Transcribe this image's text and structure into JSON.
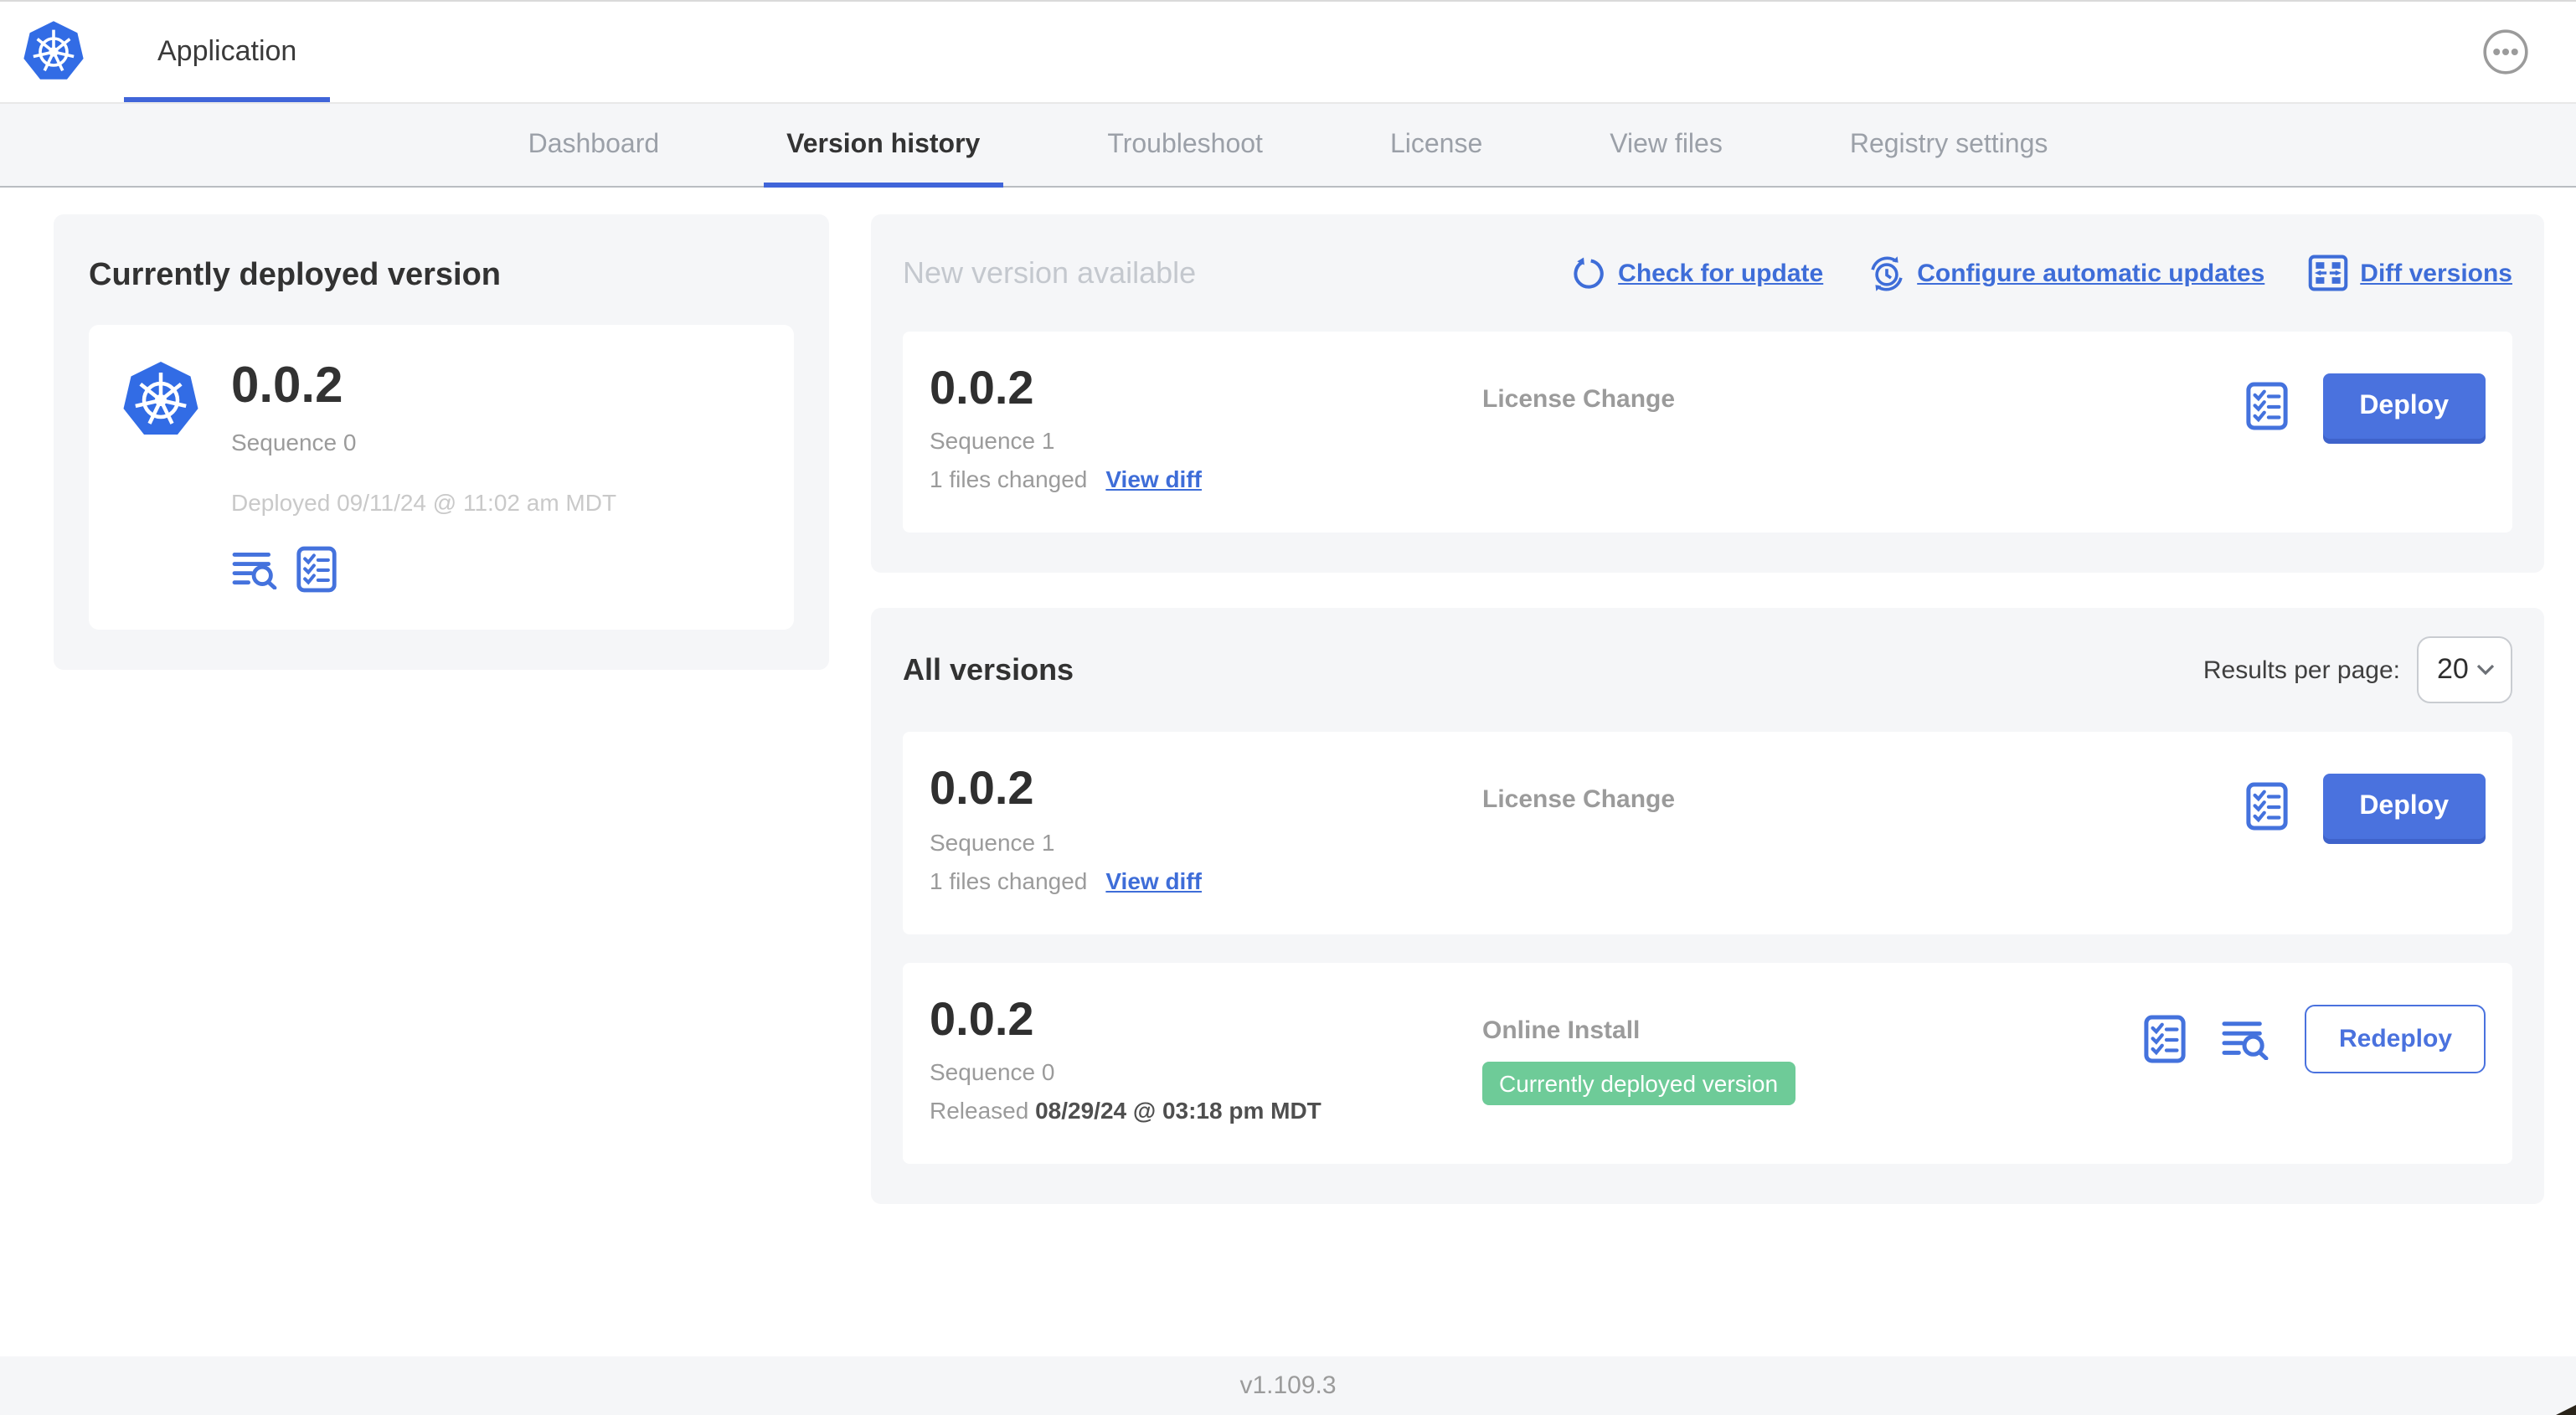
{
  "header": {
    "app_tab": "Application"
  },
  "nav": {
    "tabs": [
      {
        "label": "Dashboard",
        "active": false
      },
      {
        "label": "Version history",
        "active": true
      },
      {
        "label": "Troubleshoot",
        "active": false
      },
      {
        "label": "License",
        "active": false
      },
      {
        "label": "View files",
        "active": false
      },
      {
        "label": "Registry settings",
        "active": false
      }
    ]
  },
  "deployed": {
    "title": "Currently deployed version",
    "version": "0.0.2",
    "sequence": "Sequence 0",
    "deployed_at": "Deployed 09/11/24 @ 11:02 am MDT",
    "icons": [
      "logs-icon",
      "preflight-checklist-icon"
    ]
  },
  "new_version": {
    "title": "New version available",
    "links": [
      {
        "label": "Check for update",
        "icon": "refresh-icon"
      },
      {
        "label": "Configure automatic updates",
        "icon": "auto-update-clock-icon"
      },
      {
        "label": "Diff versions",
        "icon": "diff-icon"
      }
    ],
    "row": {
      "version": "0.0.2",
      "sequence": "Sequence 1",
      "files_changed": "1 files changed",
      "view_diff": "View diff",
      "source": "License Change",
      "deploy_label": "Deploy"
    }
  },
  "all_versions": {
    "title": "All versions",
    "results_per_page_label": "Results per page:",
    "results_per_page_value": "20",
    "rows": [
      {
        "version": "0.0.2",
        "sequence": "Sequence 1",
        "files_changed": "1 files changed",
        "view_diff": "View diff",
        "source": "License Change",
        "action_label": "Deploy",
        "icons": [
          "preflight-checklist-icon"
        ]
      },
      {
        "version": "0.0.2",
        "sequence": "Sequence 0",
        "released_prefix": "Released ",
        "released_date": "08/29/24 @ 03:18 pm MDT",
        "source": "Online Install",
        "badge": "Currently deployed version",
        "action_label": "Redeploy",
        "icons": [
          "preflight-checklist-icon",
          "logs-icon"
        ]
      }
    ]
  },
  "footer": {
    "version": "v1.109.3"
  },
  "colors": {
    "primary_blue": "#4a72de",
    "link_blue": "#3e6dd8",
    "logo_blue": "#326ce5",
    "badge_green": "#6ecb98",
    "panel_gray": "#f5f6f8"
  }
}
